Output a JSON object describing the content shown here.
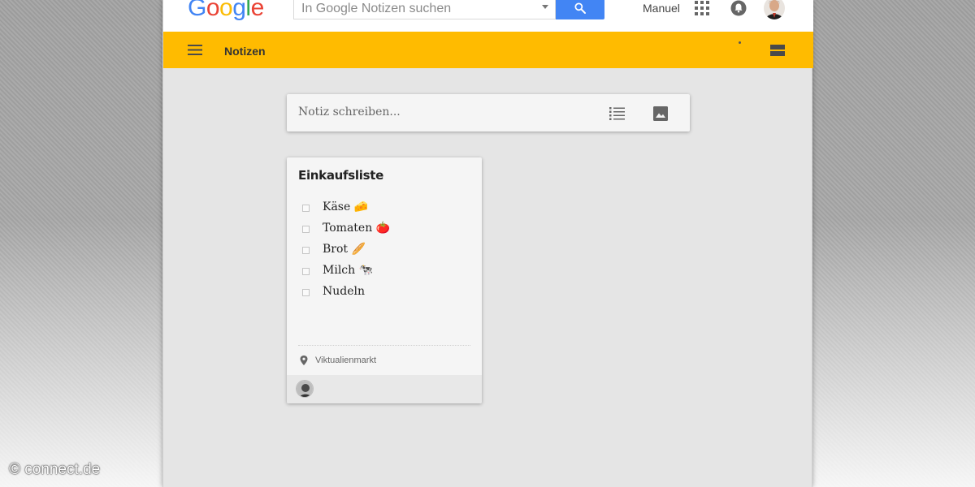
{
  "header": {
    "logo_letters": [
      "G",
      "o",
      "o",
      "g",
      "l",
      "e"
    ],
    "search_placeholder": "In Google Notizen suchen",
    "user_name": "Manuel",
    "icons": [
      "search-icon",
      "apps-grid-icon",
      "notifications-bell-icon",
      "user-avatar"
    ]
  },
  "toolbar": {
    "title": "Notizen",
    "icons": [
      "menu-icon",
      "list-view-icon"
    ]
  },
  "take_note": {
    "placeholder": "Notiz schreiben...",
    "icons": [
      "checklist-icon",
      "image-icon"
    ]
  },
  "note": {
    "title": "Einkaufsliste",
    "items": [
      {
        "label": "Käse 🧀",
        "checked": false
      },
      {
        "label": "Tomaten 🍅",
        "checked": false
      },
      {
        "label": "Brot 🥖",
        "checked": false
      },
      {
        "label": "Milch 🐄",
        "checked": false
      },
      {
        "label": "Nudeln",
        "checked": false
      }
    ],
    "location": "Viktualienmarkt"
  },
  "watermark": "© connect.de",
  "colors": {
    "accent_yellow": "#ffbb00",
    "search_blue": "#4285f4",
    "background": "#e5e5e5"
  }
}
